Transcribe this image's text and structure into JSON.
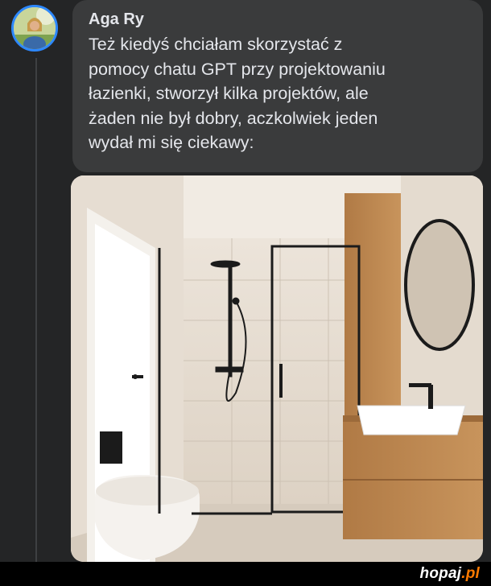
{
  "post": {
    "author": "Aga Ry",
    "lines": [
      "Też kiedyś chciałam skorzystać z",
      "pomocy chatu GPT przy projektowaniu",
      "łazienki, stworzył kilka projektów, ale",
      "żaden nie był dobry, aczkolwiek jeden",
      "wydał mi się ciekawy:"
    ]
  },
  "watermark": {
    "brand": "hopaj",
    "dot": ".",
    "tld": "pl"
  },
  "colors": {
    "avatar_ring": "#2d88ff",
    "bubble": "#3a3b3c",
    "background": "#242526",
    "watermark_accent": "#ff7a00"
  }
}
